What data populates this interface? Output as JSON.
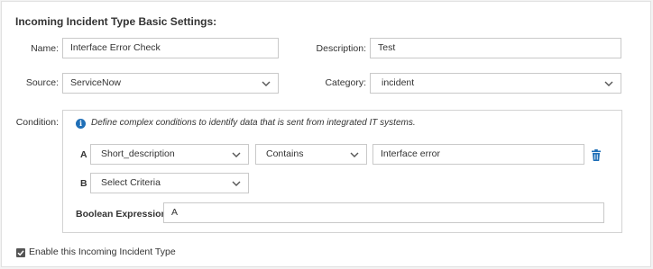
{
  "section": {
    "title": "Incoming Incident Type Basic Settings:"
  },
  "fields": {
    "name_label": "Name:",
    "name_value": "Interface Error Check",
    "description_label": "Description:",
    "description_value": "Test",
    "source_label": "Source:",
    "source_value": "ServiceNow",
    "category_label": "Category:",
    "category_value": "incident"
  },
  "condition": {
    "label": "Condition:",
    "info_text": "Define complex conditions to identify data that is sent from integrated IT systems.",
    "rows": [
      {
        "letter": "A",
        "field": "Short_description",
        "operator": "Contains",
        "value": "Interface error"
      },
      {
        "letter": "B",
        "field": "Select Criteria"
      }
    ],
    "boolean_label": "Boolean Expression:",
    "boolean_value": "A"
  },
  "enable": {
    "label": "Enable this Incoming Incident Type",
    "checked": true
  },
  "colors": {
    "accent": "#1f6fb7",
    "border": "#c9c9c9",
    "background": "#f3f3f3"
  },
  "icons": [
    "info-icon",
    "chevron-down-icon",
    "trash-icon",
    "checkbox-checked-icon"
  ]
}
